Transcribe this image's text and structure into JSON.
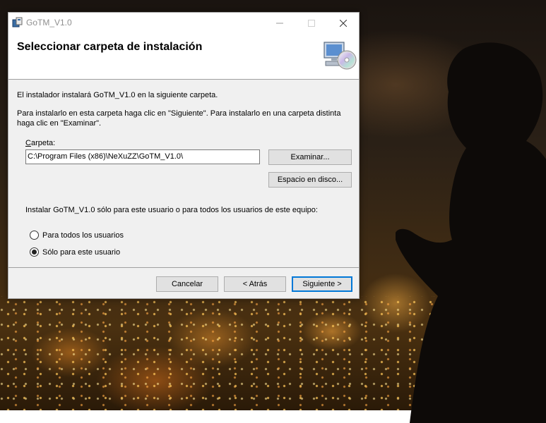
{
  "window": {
    "title": "GoTM_V1.0",
    "header_title": "Seleccionar carpeta de instalación"
  },
  "content": {
    "intro": "El instalador instalará GoTM_V1.0 en la siguiente carpeta.",
    "instructions": "Para instalarlo en esta carpeta haga clic en \"Siguiente\". Para instalarlo en una carpeta distinta haga clic en \"Examinar\".",
    "folder_label": "Carpeta:",
    "folder_value": "C:\\Program Files (x86)\\NeXuZZ\\GoTM_V1.0\\",
    "browse_label": "Examinar...",
    "disk_space_label": "Espacio en disco...",
    "scope_question": "Instalar GoTM_V1.0 sólo para este usuario o para todos los usuarios de este equipo:",
    "radio_all": "Para todos los usuarios",
    "radio_me": "Sólo para este usuario",
    "selected_scope": "Sólo para este usuario"
  },
  "footer": {
    "cancel_label": "Cancelar",
    "back_label": "< Atrás",
    "next_label": "Siguiente >"
  },
  "icons": {
    "app": "installer-app-icon",
    "header": "computer-cd-icon",
    "minimize": "minimize-icon",
    "maximize": "maximize-icon",
    "close": "close-icon"
  },
  "colors": {
    "accent": "#0078d7",
    "window_bg": "#f0f0f0",
    "button_bg": "#e1e1e1"
  }
}
